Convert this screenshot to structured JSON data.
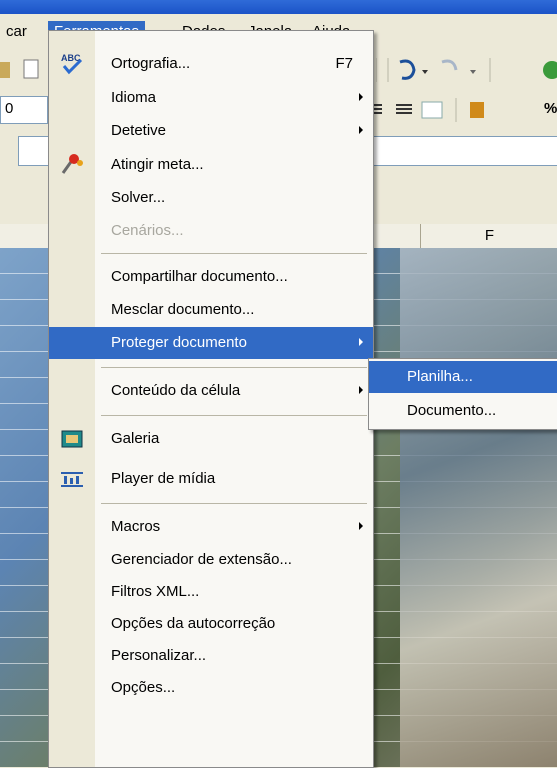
{
  "menubar": {
    "items": [
      {
        "label": "car"
      },
      {
        "label": "Ferramentas"
      },
      {
        "label": "Dados"
      },
      {
        "label": "Janela"
      },
      {
        "label": "Ajuda"
      }
    ]
  },
  "toolbar": {
    "font_size_value": "0",
    "percent_symbol": "%"
  },
  "sheet": {
    "column_header": "F"
  },
  "tools_menu": {
    "items": [
      {
        "label": "Ortografia...",
        "accel": "F7"
      },
      {
        "label": "Idioma"
      },
      {
        "label": "Detetive"
      },
      {
        "label": "Atingir meta..."
      },
      {
        "label": "Solver..."
      },
      {
        "label": "Cenários..."
      },
      {
        "label": "Compartilhar documento..."
      },
      {
        "label": "Mesclar documento..."
      },
      {
        "label": "Proteger documento"
      },
      {
        "label": "Conteúdo da célula"
      },
      {
        "label": "Galeria"
      },
      {
        "label": "Player de mídia"
      },
      {
        "label": "Macros"
      },
      {
        "label": "Gerenciador de extensão..."
      },
      {
        "label": "Filtros XML..."
      },
      {
        "label": "Opções da autocorreção"
      },
      {
        "label": "Personalizar..."
      },
      {
        "label": "Opções..."
      }
    ]
  },
  "protect_submenu": {
    "items": [
      {
        "label": "Planilha..."
      },
      {
        "label": "Documento..."
      }
    ]
  },
  "icons": {
    "spellcheck_badge": "ABC"
  }
}
